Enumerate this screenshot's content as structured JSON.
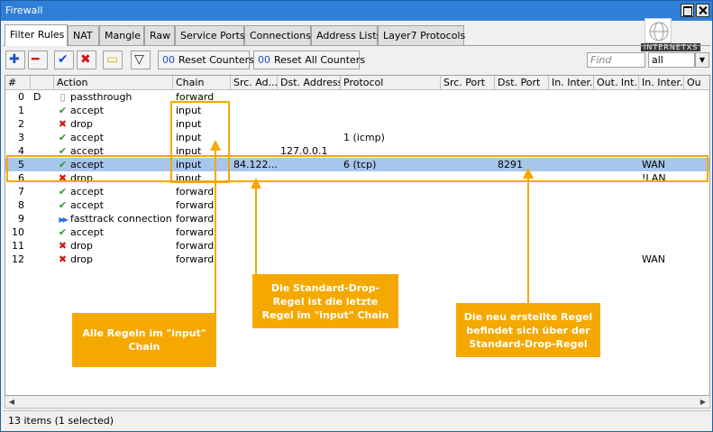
{
  "window": {
    "title": "Firewall"
  },
  "tabs": [
    "Filter Rules",
    "NAT",
    "Mangle",
    "Raw",
    "Service Ports",
    "Connections",
    "Address Lists",
    "Layer7 Protocols"
  ],
  "logo": {
    "text": "INTERNETXS"
  },
  "toolbar": {
    "reset_counters": "Reset Counters",
    "reset_all_counters": "Reset All Counters",
    "find_placeholder": "Find",
    "filter_value": "all"
  },
  "columns": [
    "#",
    "Action",
    "Chain",
    "Src. Ad...",
    "Dst. Address",
    "Protocol",
    "Src. Port",
    "Dst. Port",
    "In. Inter...",
    "Out. Int...",
    "In. Inter...",
    "Ou"
  ],
  "rows": [
    {
      "num": "0",
      "flag": "D",
      "action": "passthrough",
      "type": "pass",
      "chain": "forward",
      "src": "",
      "dst": "",
      "proto": "",
      "dport": "",
      "in": ""
    },
    {
      "num": "1",
      "flag": "",
      "action": "accept",
      "type": "accept",
      "chain": "input",
      "src": "",
      "dst": "",
      "proto": "",
      "dport": "",
      "in": ""
    },
    {
      "num": "2",
      "flag": "",
      "action": "drop",
      "type": "drop",
      "chain": "input",
      "src": "",
      "dst": "",
      "proto": "",
      "dport": "",
      "in": ""
    },
    {
      "num": "3",
      "flag": "",
      "action": "accept",
      "type": "accept",
      "chain": "input",
      "src": "",
      "dst": "",
      "proto": "1 (icmp)",
      "dport": "",
      "in": ""
    },
    {
      "num": "4",
      "flag": "",
      "action": "accept",
      "type": "accept",
      "chain": "input",
      "src": "",
      "dst": "127.0.0.1",
      "proto": "",
      "dport": "",
      "in": ""
    },
    {
      "num": "5",
      "flag": "",
      "action": "accept",
      "type": "accept",
      "chain": "input",
      "src": "84.122....",
      "dst": "",
      "proto": "6 (tcp)",
      "dport": "8291",
      "in": "WAN",
      "selected": true
    },
    {
      "num": "6",
      "flag": "",
      "action": "drop",
      "type": "drop",
      "chain": "input",
      "src": "",
      "dst": "",
      "proto": "",
      "dport": "",
      "in": "!LAN"
    },
    {
      "num": "7",
      "flag": "",
      "action": "accept",
      "type": "accept",
      "chain": "forward",
      "src": "",
      "dst": "",
      "proto": "",
      "dport": "",
      "in": ""
    },
    {
      "num": "8",
      "flag": "",
      "action": "accept",
      "type": "accept",
      "chain": "forward",
      "src": "",
      "dst": "",
      "proto": "",
      "dport": "",
      "in": ""
    },
    {
      "num": "9",
      "flag": "",
      "action": "fasttrack connection",
      "type": "fast",
      "chain": "forward",
      "src": "",
      "dst": "",
      "proto": "",
      "dport": "",
      "in": ""
    },
    {
      "num": "10",
      "flag": "",
      "action": "accept",
      "type": "accept",
      "chain": "forward",
      "src": "",
      "dst": "",
      "proto": "",
      "dport": "",
      "in": ""
    },
    {
      "num": "11",
      "flag": "",
      "action": "drop",
      "type": "drop",
      "chain": "forward",
      "src": "",
      "dst": "",
      "proto": "",
      "dport": "",
      "in": ""
    },
    {
      "num": "12",
      "flag": "",
      "action": "drop",
      "type": "drop",
      "chain": "forward",
      "src": "",
      "dst": "",
      "proto": "",
      "dport": "",
      "in": "WAN"
    }
  ],
  "annotations": {
    "input_chain": "Alle Regeln im \"input\" Chain",
    "default_drop": "Die Standard-Drop-Regel ist die letzte Regel im \"input\" Chain",
    "new_rule": "Die neu erstellte Regel befindet sich über der Standard-Drop-Regel"
  },
  "status": {
    "text": "13 items (1 selected)"
  },
  "colors": {
    "accent": "#f5a800",
    "titlebar": "#2f7ed8",
    "selection": "#a8c6ec"
  }
}
